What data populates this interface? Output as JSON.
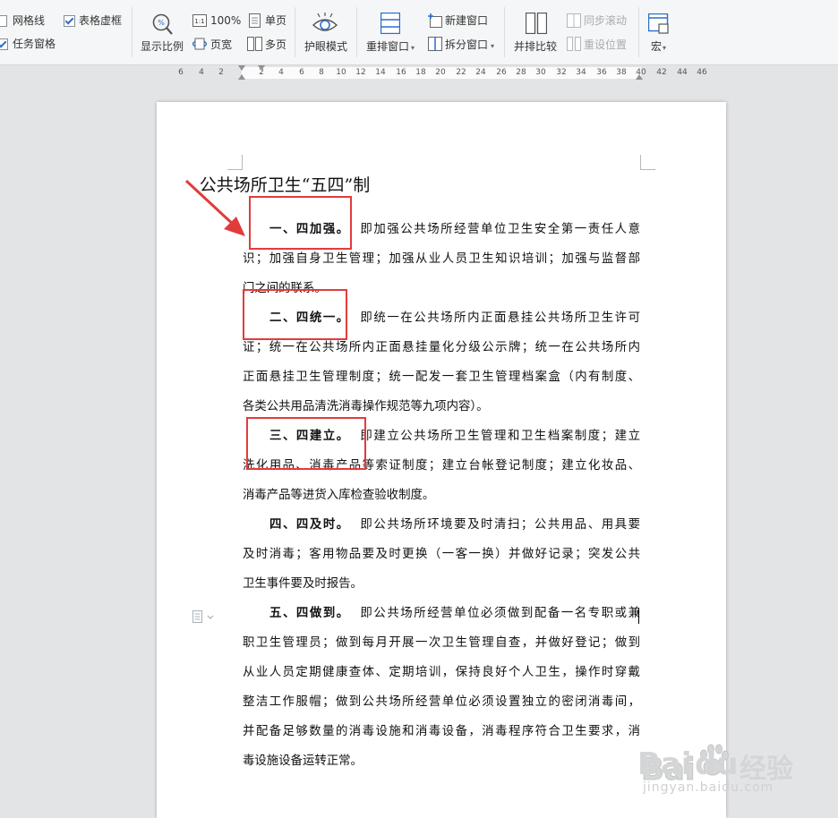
{
  "ribbon": {
    "grid_lines": "网格线",
    "table_gridlines": "表格虚框",
    "task_pane": "任务窗格",
    "zoom_label": "显示比例",
    "zoom_100": "100%",
    "page_width": "页宽",
    "single_page": "单页",
    "multi_page": "多页",
    "eye_protection": "护眼模式",
    "arrange_window": "重排窗口",
    "new_window": "新建窗口",
    "split_window": "拆分窗口",
    "side_by_side": "并排比较",
    "sync_scroll": "同步滚动",
    "reset_position": "重设位置",
    "macro": "宏"
  },
  "ruler": {
    "ticks": [
      "6",
      "4",
      "2",
      "2",
      "4",
      "6",
      "8",
      "10",
      "12",
      "14",
      "16",
      "18",
      "20",
      "22",
      "24",
      "26",
      "28",
      "30",
      "32",
      "34",
      "36",
      "38",
      "40",
      "42",
      "44",
      "46"
    ]
  },
  "document": {
    "title": "公共场所卫生“五四”制",
    "lines": [
      {
        "heading": "一、四加强。",
        "text": "  即加强公共场所经营单位卫生安全第一责任人意"
      },
      {
        "heading": "",
        "text": "识；加强自身卫生管理；加强从业人员卫生知识培训；加强与监督部"
      },
      {
        "heading": "",
        "text": "门之间的联系。"
      },
      {
        "heading": "二、四统一。",
        "text": "  即统一在公共场所内正面悬挂公共场所卫生许可"
      },
      {
        "heading": "",
        "text": "证；统一在公共场所内正面悬挂量化分级公示牌；统一在公共场所内"
      },
      {
        "heading": "",
        "text": "正面悬挂卫生管理制度；统一配发一套卫生管理档案盒（内有制度、"
      },
      {
        "heading": "",
        "text": "各类公共用品清洗消毒操作规范等九项内容）。"
      },
      {
        "heading": "三、四建立。",
        "text": "  即建立公共场所卫生管理和卫生档案制度；建立"
      },
      {
        "heading": "",
        "text": "洗化用品、消毒产品等索证制度；建立台帐登记制度；建立化妆品、"
      },
      {
        "heading": "",
        "text": "消毒产品等进货入库检查验收制度。"
      },
      {
        "heading": "四、四及时。",
        "text": "  即公共场所环境要及时清扫；公共用品、用具要"
      },
      {
        "heading": "",
        "text": "及时消毒；客用物品要及时更换（一客一换）并做好记录；突发公共"
      },
      {
        "heading": "",
        "text": "卫生事件要及时报告。"
      },
      {
        "heading": "五、四做到。",
        "text": "  即公共场所经营单位必须做到配备一名专职或兼"
      },
      {
        "heading": "",
        "text": "职卫生管理员；做到每月开展一次卫生管理自查，并做好登记；做到"
      },
      {
        "heading": "",
        "text": "从业人员定期健康查体、定期培训，保持良好个人卫生，操作时穿戴"
      },
      {
        "heading": "",
        "text": "整洁工作服帽；做到公共场所经营单位必须设置独立的密闭消毒间，"
      },
      {
        "heading": "",
        "text": "并配备足够数量的消毒设施和消毒设备，消毒程序符合卫生要求，消"
      },
      {
        "heading": "",
        "text": "毒设施设备运转正常。"
      }
    ]
  },
  "watermark": {
    "brand": "Bai",
    "brand2": "du",
    "cn": "经验",
    "url": "jingyan.baidu.com"
  },
  "colors": {
    "annotation_red": "#e23b3b",
    "accent_blue": "#2c6ecb"
  }
}
